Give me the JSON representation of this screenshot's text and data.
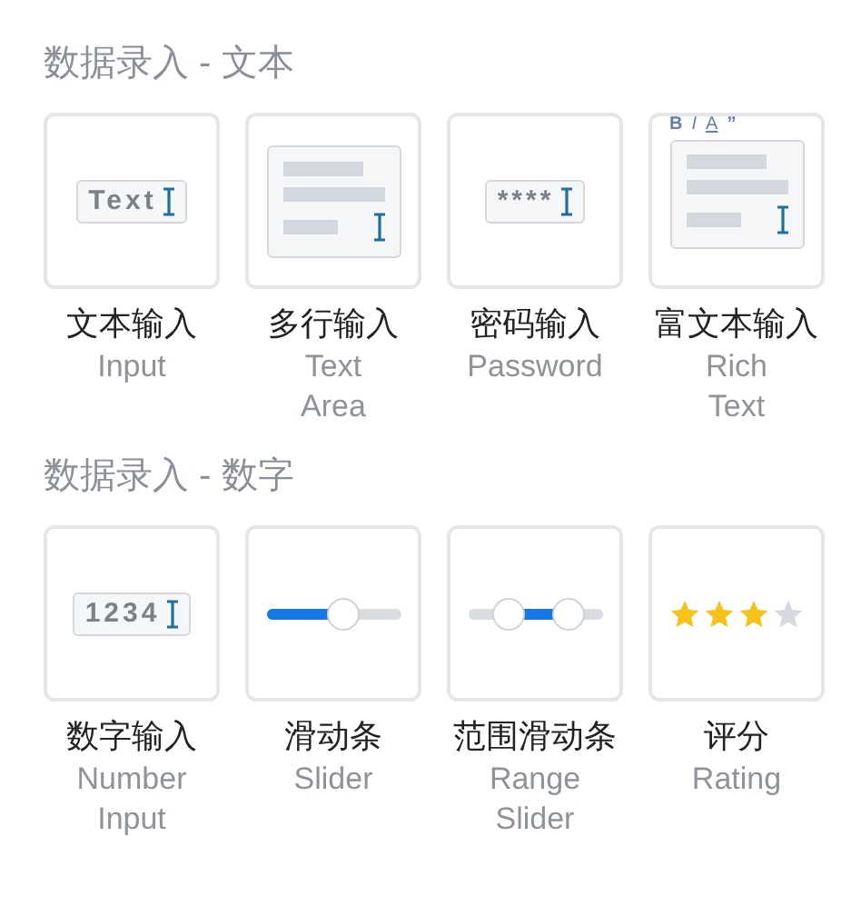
{
  "sections": [
    {
      "title": "数据录入 - 文本",
      "items": [
        {
          "kind": "text_input",
          "preview": "Text",
          "zh": "文本输入",
          "en": [
            "Input"
          ]
        },
        {
          "kind": "textarea",
          "zh": "多行输入",
          "en": [
            "Text",
            "Area"
          ]
        },
        {
          "kind": "password",
          "preview": "****",
          "zh": "密码输入",
          "en": [
            "Password"
          ]
        },
        {
          "kind": "rich_text",
          "toolbar": [
            {
              "kind": "bold",
              "label": "B"
            },
            {
              "kind": "italic",
              "label": "I"
            },
            {
              "kind": "underline",
              "label": "A"
            },
            {
              "kind": "quote",
              "label": "”"
            }
          ],
          "zh": "富文本输入",
          "en": [
            "Rich",
            "Text"
          ]
        }
      ]
    },
    {
      "title": "数据录入 - 数字",
      "items": [
        {
          "kind": "number_input",
          "preview": "1234",
          "zh": "数字输入",
          "en": [
            "Number",
            "Input"
          ]
        },
        {
          "kind": "slider",
          "level": 0.58,
          "zh": "滑动条",
          "en": [
            "Slider"
          ]
        },
        {
          "kind": "range_slider",
          "handles": [
            {
              "level": 0.3
            },
            {
              "level": 0.75
            }
          ],
          "zh": "范围滑动条",
          "en": [
            "Range",
            "Slider"
          ]
        },
        {
          "kind": "rating",
          "stars": 3,
          "zh": "评分",
          "en": [
            "Rating"
          ]
        }
      ]
    }
  ]
}
